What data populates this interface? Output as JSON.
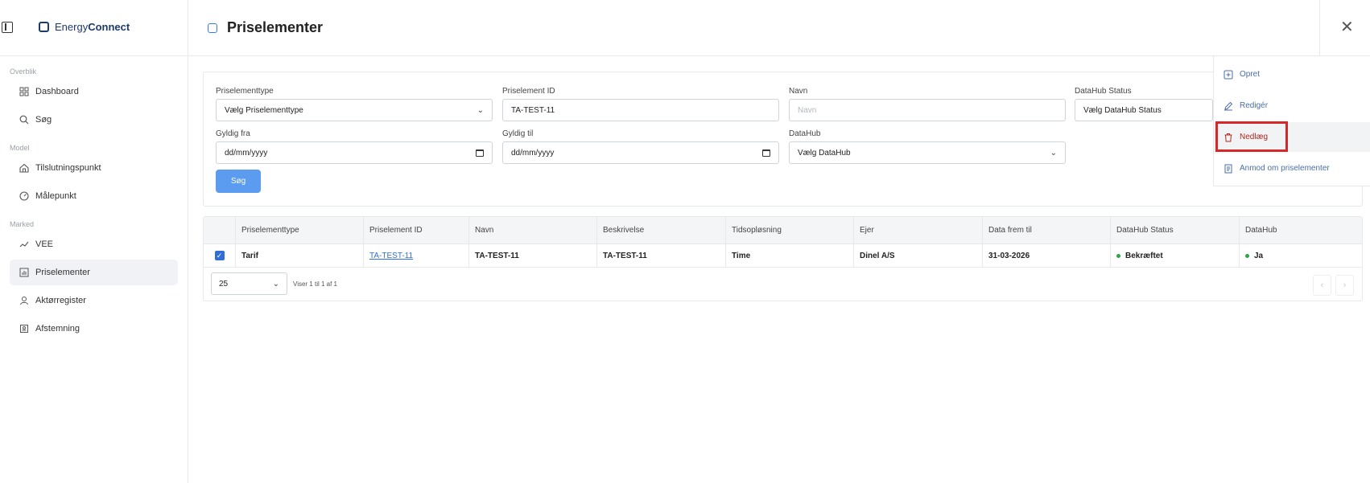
{
  "brand": {
    "prefix": "Energy",
    "suffix": "Connect"
  },
  "sidebar": {
    "sections": [
      {
        "label": "Overblik",
        "items": [
          {
            "label": "Dashboard",
            "icon": "grid-icon"
          },
          {
            "label": "Søg",
            "icon": "search-icon"
          }
        ]
      },
      {
        "label": "Model",
        "items": [
          {
            "label": "Tilslutningspunkt",
            "icon": "home-icon"
          },
          {
            "label": "Målepunkt",
            "icon": "gauge-icon"
          }
        ]
      },
      {
        "label": "Marked",
        "items": [
          {
            "label": "VEE",
            "icon": "trend-icon"
          },
          {
            "label": "Priselementer",
            "icon": "chart-icon",
            "active": true
          },
          {
            "label": "Aktørregister",
            "icon": "user-icon"
          },
          {
            "label": "Afstemning",
            "icon": "balance-icon"
          }
        ]
      }
    ]
  },
  "header": {
    "title": "Priselementer"
  },
  "filters": {
    "type_label": "Priselementtype",
    "type_value": "Vælg Priselementtype",
    "id_label": "Priselement ID",
    "id_value": "TA-TEST-11",
    "name_label": "Navn",
    "name_placeholder": "Navn",
    "status_label": "DataHub Status",
    "status_value": "Vælg DataHub Status",
    "from_label": "Gyldig fra",
    "from_value": "dd/mm/yyyy",
    "to_label": "Gyldig til",
    "to_value": "dd/mm/yyyy",
    "datahub_label": "DataHub",
    "datahub_value": "Vælg DataHub",
    "search_label": "Søg"
  },
  "table": {
    "columns": [
      "Priselementtype",
      "Priselement ID",
      "Navn",
      "Beskrivelse",
      "Tidsopløsning",
      "Ejer",
      "Data frem til",
      "DataHub Status",
      "DataHub"
    ],
    "rows": [
      {
        "type": "Tarif",
        "id": "TA-TEST-11",
        "name": "TA-TEST-11",
        "desc": "TA-TEST-11",
        "resolution": "Time",
        "owner": "Dinel A/S",
        "until": "31-03-2026",
        "status": "Bekræftet",
        "datahub": "Ja"
      }
    ],
    "page_size": "25",
    "info": "Viser 1 til 1 af 1"
  },
  "menu": {
    "create": "Opret",
    "edit": "Redigér",
    "delete": "Nedlæg",
    "request": "Anmod om priselementer"
  },
  "colors": {
    "accent": "#2f6fd6",
    "button": "#5b9bf0",
    "status_ok": "#28a745",
    "highlight": "#d62828"
  }
}
